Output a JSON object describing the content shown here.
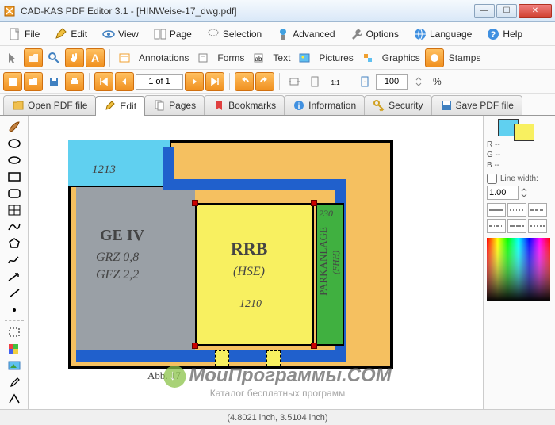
{
  "window": {
    "title": "CAD-KAS PDF Editor 3.1 - [HINWeise-17_dwg.pdf]"
  },
  "menu": {
    "file": "File",
    "edit": "Edit",
    "view": "View",
    "page": "Page",
    "selection": "Selection",
    "advanced": "Advanced",
    "options": "Options",
    "language": "Language",
    "help": "Help"
  },
  "toolbar": {
    "annotations": "Annotations",
    "forms": "Forms",
    "text": "Text",
    "pictures": "Pictures",
    "graphics": "Graphics",
    "stamps": "Stamps",
    "page_of": "1 of 1",
    "zoom": "100",
    "percent": "%"
  },
  "tabs": {
    "open": "Open PDF file",
    "edit": "Edit",
    "pages": "Pages",
    "bookmarks": "Bookmarks",
    "info": "Information",
    "security": "Security",
    "save": "Save PDF file"
  },
  "canvas": {
    "label_1213": "1213",
    "label_ge": "GE IV",
    "label_grz": "GRZ 0,8",
    "label_gfz": "GFZ 2,2",
    "label_rrb": "RRB",
    "label_hse": "(HSE)",
    "label_1210": "1210",
    "label_230": "230",
    "label_park": "PARKANLAGE",
    "label_fhh": "(FHH)",
    "label_abb": "Abb. 17"
  },
  "props": {
    "r": "R --",
    "g": "G --",
    "b": "B --",
    "linewidth_label": "Line width:",
    "linewidth": "1.00"
  },
  "status": "(4.8021 inch, 3.5104 inch)",
  "watermark": {
    "line1": "МоиПрограммы.COM",
    "line2": "Каталог бесплатных программ"
  }
}
